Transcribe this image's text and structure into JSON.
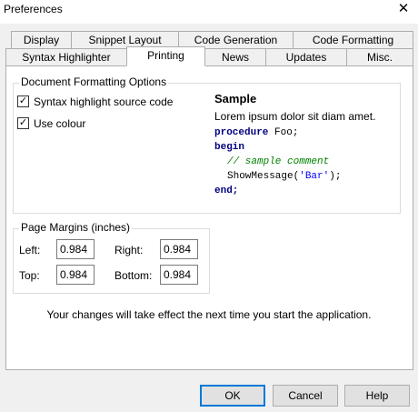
{
  "window": {
    "title": "Preferences",
    "close_glyph": "✕"
  },
  "tabs": {
    "row_back": [
      {
        "label": "Display"
      },
      {
        "label": "Snippet Layout"
      },
      {
        "label": "Code Generation"
      },
      {
        "label": "Code Formatting"
      }
    ],
    "row_front": [
      {
        "label": "Syntax Highlighter"
      },
      {
        "label": "Printing",
        "active": true
      },
      {
        "label": "News"
      },
      {
        "label": "Updates"
      },
      {
        "label": "Misc."
      }
    ]
  },
  "doc_options": {
    "title": "Document Formatting Options",
    "syntax_highlight": {
      "label": "Syntax highlight source code",
      "checked": true
    },
    "use_colour": {
      "label": "Use colour",
      "checked": true
    }
  },
  "sample": {
    "heading": "Sample",
    "text": "Lorem ipsum dolor sit diam amet.",
    "code": {
      "kw_procedure": "procedure",
      "proc_rest": " Foo;",
      "kw_begin": "begin",
      "comment": "// sample comment",
      "call": "ShowMessage(",
      "string": "'Bar'",
      "call_end": ");",
      "kw_end": "end;"
    },
    "colors": {
      "keyword": "#000080",
      "comment": "#008000",
      "string": "#0000ff"
    }
  },
  "margins": {
    "title": "Page Margins (inches)",
    "left": {
      "label": "Left:",
      "value": "0.984"
    },
    "right": {
      "label": "Right:",
      "value": "0.984"
    },
    "top": {
      "label": "Top:",
      "value": "0.984"
    },
    "bottom": {
      "label": "Bottom:",
      "value": "0.984"
    }
  },
  "notice": "Your changes will take effect the next time you start the application.",
  "buttons": {
    "ok": "OK",
    "cancel": "Cancel",
    "help": "Help"
  }
}
